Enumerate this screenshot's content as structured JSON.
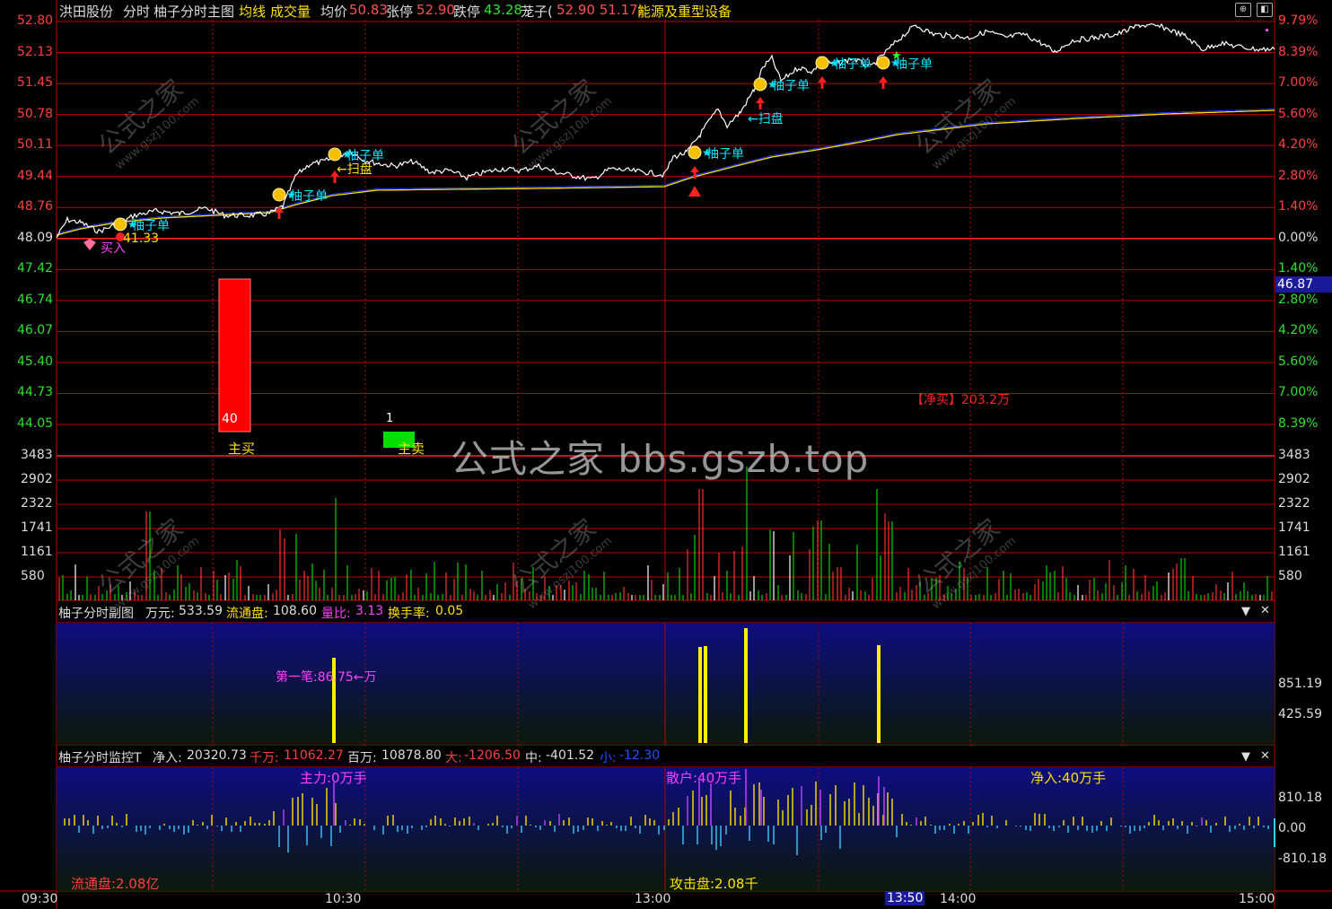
{
  "header": {
    "stock": "洪田股份",
    "mode": "分时",
    "indicator": "柚子分时主图",
    "legend_avg": "均线",
    "legend_vol": "成交量",
    "avg_label": "均价",
    "avg_value": "50.83",
    "limit_up_label": "张停",
    "limit_up_value": "52.90",
    "limit_down_label": "跌停",
    "limit_down_value": "43.28",
    "extra_label": "茏子(",
    "extra_value": "52.90 51.17)",
    "sector": "能源及重型设备"
  },
  "colors": {
    "grid": "#c00000",
    "up": "#ff3030",
    "down": "#00d000",
    "price_line": "#ffffff",
    "avg_line": "#ffe000",
    "annotation": "#00e5ff",
    "magenta": "#e040ff"
  },
  "price_axis": {
    "left": [
      "52.80",
      "52.13",
      "51.45",
      "50.78",
      "50.11",
      "49.44",
      "48.76",
      "48.09",
      "47.42",
      "46.74",
      "46.07",
      "45.40",
      "44.73",
      "44.05"
    ],
    "right": [
      "9.79%",
      "8.39%",
      "7.00%",
      "5.60%",
      "4.20%",
      "2.80%",
      "1.40%",
      "0.00%",
      "1.40%",
      "2.80%",
      "4.20%",
      "5.60%",
      "7.00%",
      "8.39%"
    ],
    "cursor_value": "46.87"
  },
  "volume_axis": {
    "left": [
      "3483",
      "2902",
      "2322",
      "1741",
      "1161",
      "580"
    ],
    "right": [
      "3483",
      "2902",
      "2322",
      "1741",
      "1161",
      "580"
    ]
  },
  "main_annotations": {
    "tags": [
      "柚子单",
      "柚子单",
      "柚子单",
      "柚子单",
      "柚子单",
      "柚子单",
      "柚子单"
    ],
    "buy_mark": "买入",
    "buy_price": "41.33",
    "sweep1": "←扫盘",
    "sweep2": "←扫盘",
    "main_buy_value": "40",
    "main_buy_label": "主买",
    "main_sell_value": "1",
    "main_sell_label": "主卖",
    "net_buy": "【净买】203.2万",
    "watermark": "公式之家 bbs.gszb.top",
    "wm_a": "公式之家",
    "wm_b": "www.gszj100.com"
  },
  "sub1": {
    "title": "柚子分时副图",
    "wan_label": "万元:",
    "wan_value": "533.59",
    "float_label": "流通盘:",
    "float_value": "108.60",
    "ratio_label": "量比:",
    "ratio_value": "3.13",
    "turnover_label": "换手率:",
    "turnover_value": "0.05",
    "first_trade": "第一笔:86.75←万",
    "axis": [
      "851.19",
      "425.59"
    ]
  },
  "sub2": {
    "title": "柚子分时监控T",
    "net_label": "净入:",
    "net_value": "20320.73",
    "qw_label": "千万:",
    "qw_value": "11062.27",
    "bw_label": "百万:",
    "bw_value": "10878.80",
    "big_label": "大:",
    "big_value": "-1206.50",
    "mid_label": "中:",
    "mid_value": "-401.52",
    "small_label": "小:",
    "small_value": "-12.30",
    "main_force": "主力:0万手",
    "retail": "散户:40万手",
    "net_in": "净入:40万手",
    "float_cap": "流通盘:2.08亿",
    "attack": "攻击盘:2.08千",
    "axis": [
      "810.18",
      "0.00",
      "-810.18"
    ]
  },
  "time_axis": {
    "labels": [
      "09:30",
      "10:30",
      "13:00",
      "13:50",
      "14:00",
      "15:00"
    ]
  },
  "controls": {
    "dropdown_icon": "triangle-down",
    "close_icon": "x"
  }
}
